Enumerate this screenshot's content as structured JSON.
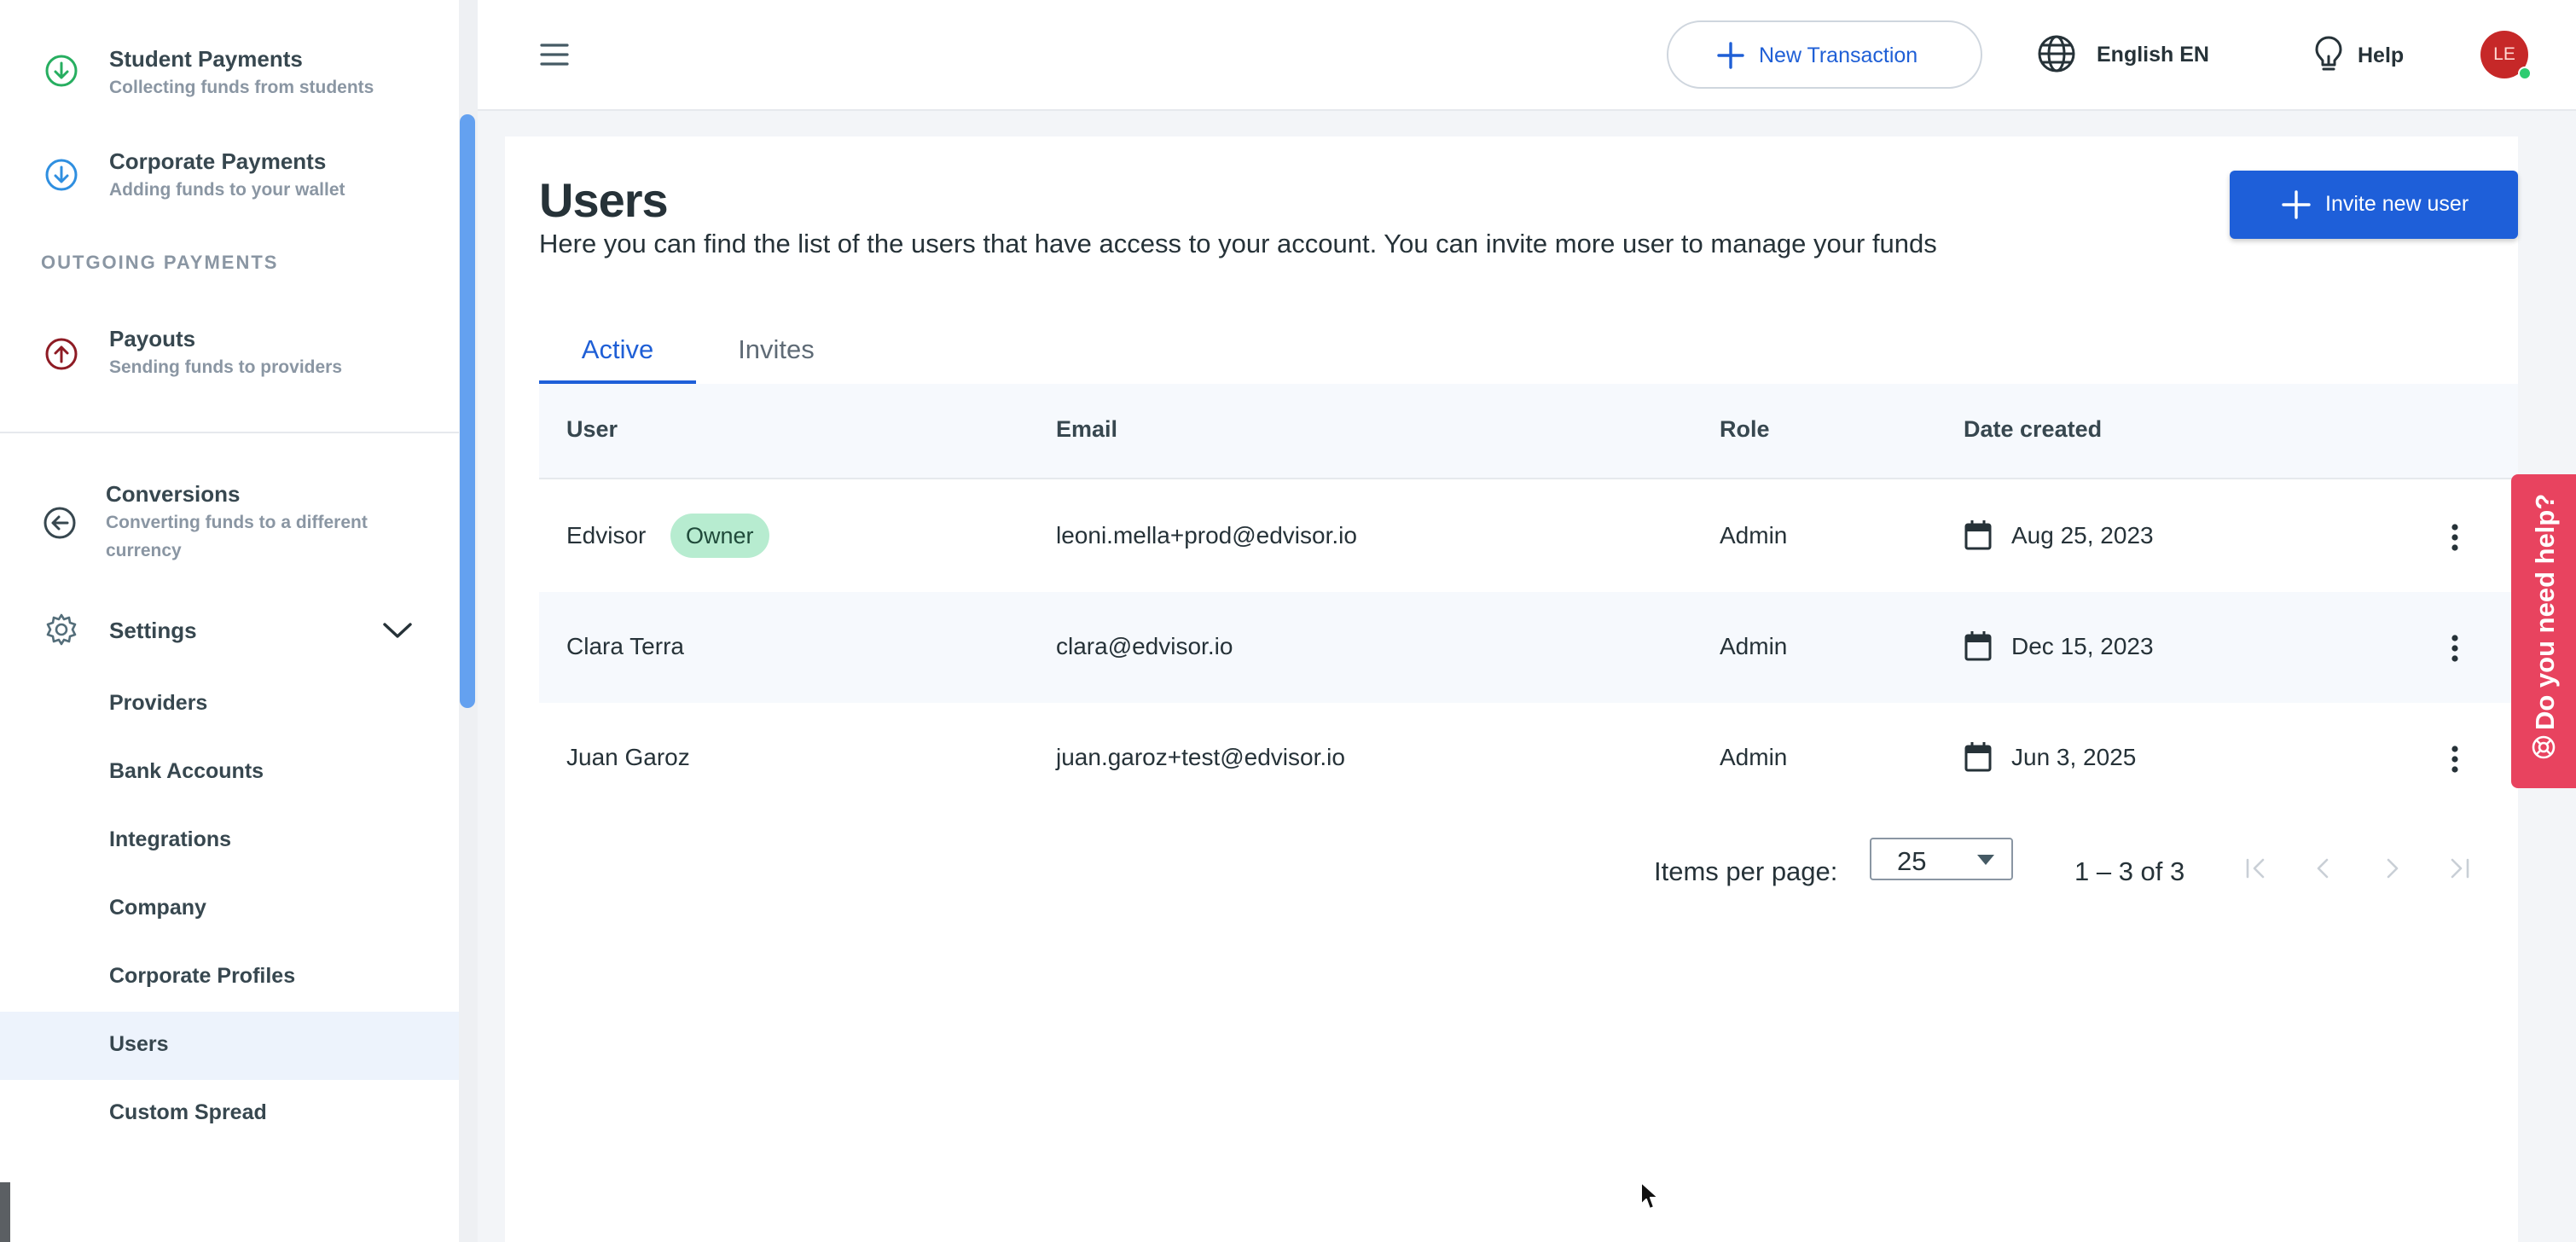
{
  "sidebar": {
    "items": [
      {
        "title": "Student Payments",
        "subtitle": "Collecting funds from students",
        "icon": "arrow-down-circle-green-icon"
      },
      {
        "title": "Corporate Payments",
        "subtitle": "Adding funds to your wallet",
        "icon": "arrow-down-circle-blue-icon"
      },
      {
        "title": "Payouts",
        "subtitle": "Sending funds to providers",
        "icon": "arrow-up-circle-red-icon"
      },
      {
        "title": "Conversions",
        "subtitle_line1": "Converting funds to a different",
        "subtitle_line2": "currency",
        "icon": "arrow-left-circle-icon"
      }
    ],
    "section_label": "OUTGOING PAYMENTS",
    "settings": {
      "label": "Settings",
      "icon": "gear-icon",
      "children": [
        "Providers",
        "Bank Accounts",
        "Integrations",
        "Company",
        "Corporate Profiles",
        "Users",
        "Custom Spread"
      ],
      "active": "Users"
    }
  },
  "topbar": {
    "new_transaction": "New Transaction",
    "language": "English EN",
    "help": "Help",
    "avatar_initials": "LE"
  },
  "main": {
    "title": "Users",
    "description": "Here you can find the list of the users that have access to your account. You can invite more user to manage your funds",
    "invite_button": "Invite new user",
    "tabs": [
      {
        "label": "Active",
        "active": true
      },
      {
        "label": "Invites",
        "active": false
      }
    ],
    "table": {
      "columns": [
        "User",
        "Email",
        "Role",
        "Date created"
      ],
      "rows": [
        {
          "user": "Edvisor",
          "badge": "Owner",
          "email": "leoni.mella+prod@edvisor.io",
          "role": "Admin",
          "date": "Aug 25, 2023"
        },
        {
          "user": "Clara Terra",
          "badge": "",
          "email": "clara@edvisor.io",
          "role": "Admin",
          "date": "Dec 15, 2023"
        },
        {
          "user": "Juan Garoz",
          "badge": "",
          "email": "juan.garoz+test@edvisor.io",
          "role": "Admin",
          "date": "Jun 3, 2025"
        }
      ]
    },
    "pagination": {
      "items_per_page_label": "Items per page:",
      "items_per_page": "25",
      "range": "1 – 3 of 3"
    }
  },
  "help_widget": {
    "label": "Do you need help?"
  },
  "colors": {
    "primary": "#1e5fd9",
    "owner_badge": "#b7ecd0",
    "help_widget": "#e8435f",
    "avatar": "#c62828",
    "online_dot": "#2ecc71"
  }
}
